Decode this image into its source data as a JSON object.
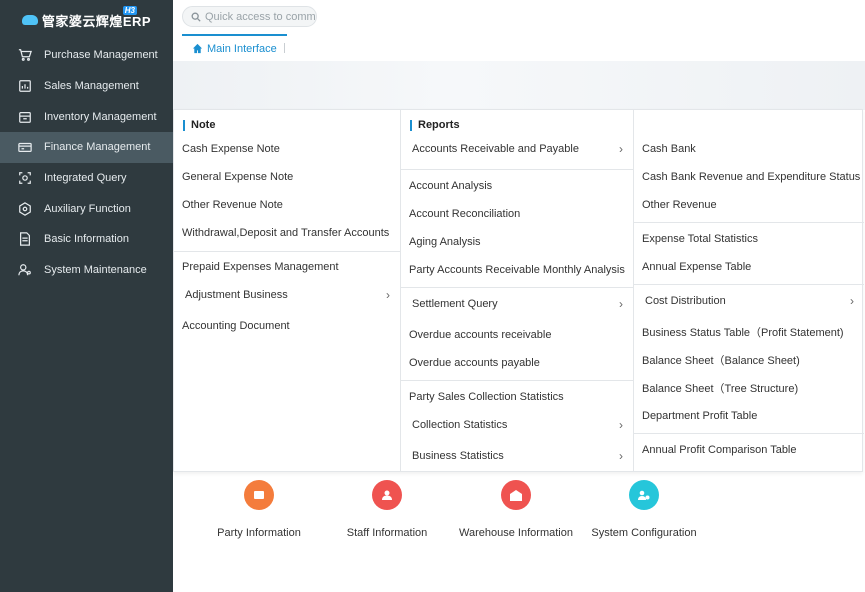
{
  "app": {
    "logo_text": "管家婆云辉煌ERP",
    "logo_badge": "H3"
  },
  "sidebar": {
    "items": [
      {
        "label": "Purchase Management",
        "icon": "cart-icon",
        "active": false
      },
      {
        "label": "Sales Management",
        "icon": "sales-chart-icon",
        "active": false
      },
      {
        "label": "Inventory Management",
        "icon": "inventory-box-icon",
        "active": false
      },
      {
        "label": "Finance Management",
        "icon": "finance-card-icon",
        "active": true
      },
      {
        "label": "Integrated Query",
        "icon": "query-scan-icon",
        "active": false
      },
      {
        "label": "Auxiliary Function",
        "icon": "hexagon-gear-icon",
        "active": false
      },
      {
        "label": "Basic Information",
        "icon": "document-icon",
        "active": false
      },
      {
        "label": "System Maintenance",
        "icon": "user-gear-icon",
        "active": false
      }
    ]
  },
  "search": {
    "placeholder": "Quick access to common functions",
    "value": ""
  },
  "tabs": [
    {
      "label": "Main Interface",
      "icon": "home-icon"
    }
  ],
  "menu": {
    "note": {
      "title": "Note",
      "items": [
        {
          "label": "Cash Expense Note"
        },
        {
          "label": "General Expense Note"
        },
        {
          "label": "Other Revenue Note"
        },
        {
          "label": "Withdrawal,Deposit and Transfer Accounts"
        },
        {
          "label": "Prepaid Expenses Management"
        },
        {
          "label": "Adjustment Business",
          "submenu": true
        },
        {
          "label": "Accounting Document"
        }
      ]
    },
    "reports": {
      "title": "Reports",
      "items": [
        {
          "label": "Accounts Receivable and Payable",
          "submenu": true
        },
        {
          "label": "Account Analysis"
        },
        {
          "label": "Account Reconciliation"
        },
        {
          "label": "Aging Analysis"
        },
        {
          "label": "Party Accounts Receivable Monthly Analysis"
        },
        {
          "label": "Settlement Query",
          "submenu": true
        },
        {
          "label": "Overdue accounts receivable"
        },
        {
          "label": "Overdue accounts payable"
        },
        {
          "label": "Party Sales Collection Statistics"
        },
        {
          "label": "Collection Statistics",
          "submenu": true
        },
        {
          "label": "Business Statistics",
          "submenu": true
        }
      ]
    },
    "col3": {
      "items": [
        {
          "label": "Cash Bank"
        },
        {
          "label": "Cash Bank Revenue and Expenditure Status"
        },
        {
          "label": "Other Revenue"
        },
        {
          "label": "Expense Total Statistics"
        },
        {
          "label": "Annual Expense Table"
        },
        {
          "label": "Cost Distribution",
          "submenu": true
        },
        {
          "label": "Business Status Table（Profit Statement)"
        },
        {
          "label": "Balance Sheet（Balance Sheet)"
        },
        {
          "label": "Balance Sheet（Tree Structure)"
        },
        {
          "label": "Department Profit Table"
        },
        {
          "label": "Annual Profit Comparison Table"
        }
      ]
    }
  },
  "quick_access": [
    {
      "label": "Party Information",
      "icon": "party-info-icon",
      "color": "#f47c3c"
    },
    {
      "label": "Staff Information",
      "icon": "staff-info-icon",
      "color": "#ef5350"
    },
    {
      "label": "Warehouse Information",
      "icon": "warehouse-icon",
      "color": "#ef5350"
    },
    {
      "label": "System Configuration",
      "icon": "system-config-icon",
      "color": "#26c6da"
    }
  ],
  "colors": {
    "sidebar_bg": "#2f3a3f",
    "sidebar_active": "#4a5a62",
    "accent": "#1a8fd0"
  }
}
